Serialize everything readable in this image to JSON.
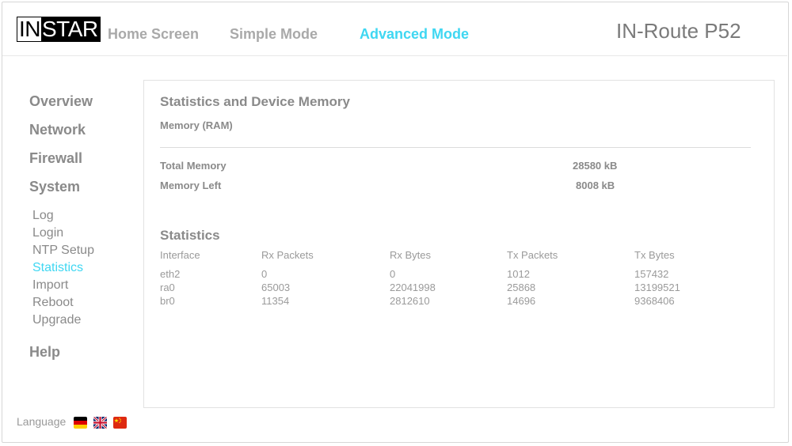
{
  "header": {
    "logo_left": "IN",
    "logo_right": "STAR",
    "nav": [
      "Home Screen",
      "Simple Mode",
      "Advanced Mode"
    ],
    "active_nav": "Advanced Mode",
    "product": "IN-Route P52"
  },
  "sidebar": {
    "main": [
      "Overview",
      "Network",
      "Firewall",
      "System"
    ],
    "system_items": [
      "Log",
      "Login",
      "NTP Setup",
      "Statistics",
      "Import",
      "Reboot",
      "Upgrade"
    ],
    "active_item": "Statistics",
    "help": "Help",
    "language_label": "Language",
    "flags": [
      "german-flag-icon",
      "uk-flag-icon",
      "china-flag-icon"
    ]
  },
  "content": {
    "title": "Statistics and Device Memory",
    "memory_heading": "Memory (RAM)",
    "total_memory_label": "Total Memory",
    "total_memory_value": "28580 kB",
    "memory_left_label": "Memory Left",
    "memory_left_value": "8008 kB",
    "stats_title": "Statistics",
    "table": {
      "headers": [
        "Interface",
        "Rx Packets",
        "Rx Bytes",
        "Tx Packets",
        "Tx Bytes"
      ],
      "rows": [
        [
          "eth2",
          "0",
          "0",
          "1012",
          "157432"
        ],
        [
          "ra0",
          "65003",
          "22041998",
          "25868",
          "13199521"
        ],
        [
          "br0",
          "11354",
          "2812610",
          "14696",
          "9368406"
        ]
      ]
    }
  },
  "colors": {
    "accent": "#3fd7f2",
    "text": "#8a8a8a"
  }
}
